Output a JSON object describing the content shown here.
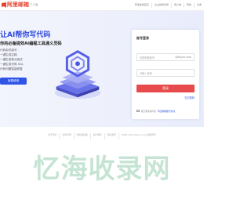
{
  "header": {
    "logo_text": "阿里邮箱",
    "logo_sub": "个人版",
    "nav": [
      "阿里邮箱首页",
      "企业邮箱登录",
      "客户端",
      "帮助",
      "注册"
    ]
  },
  "hero": {
    "title": "让AI帮你写代码",
    "subtitle": "你的必备提效AI编程工具通义灵码",
    "features": [
      "代码实时续写",
      "一键生成注释",
      "一键生成单元测试",
      "一键生成代码 SQL",
      "代码问题智能修复"
    ],
    "cta_label": "免费使用"
  },
  "login": {
    "title": "账号登录",
    "username_placeholder": "阿里邮箱账号",
    "username_suffix": "@aliyun.com",
    "password_placeholder": "请输入密码",
    "submit_label": "登录",
    "forgot_label": "忘记密码",
    "agree_text": "我已阅读并同意",
    "agree_link": "阿里邮箱服务协议"
  },
  "footer": {
    "links": [
      "关于我们",
      "法律声明",
      "隐私权政策",
      "客户服务",
      "联系我们",
      "2009-2024 Aliyun.com 版权所有"
    ]
  },
  "watermark": "忆海收录网",
  "colors": {
    "brand_red": "#e8412b",
    "accent_blue": "#2f55e8",
    "login_red": "#e74a4a"
  }
}
